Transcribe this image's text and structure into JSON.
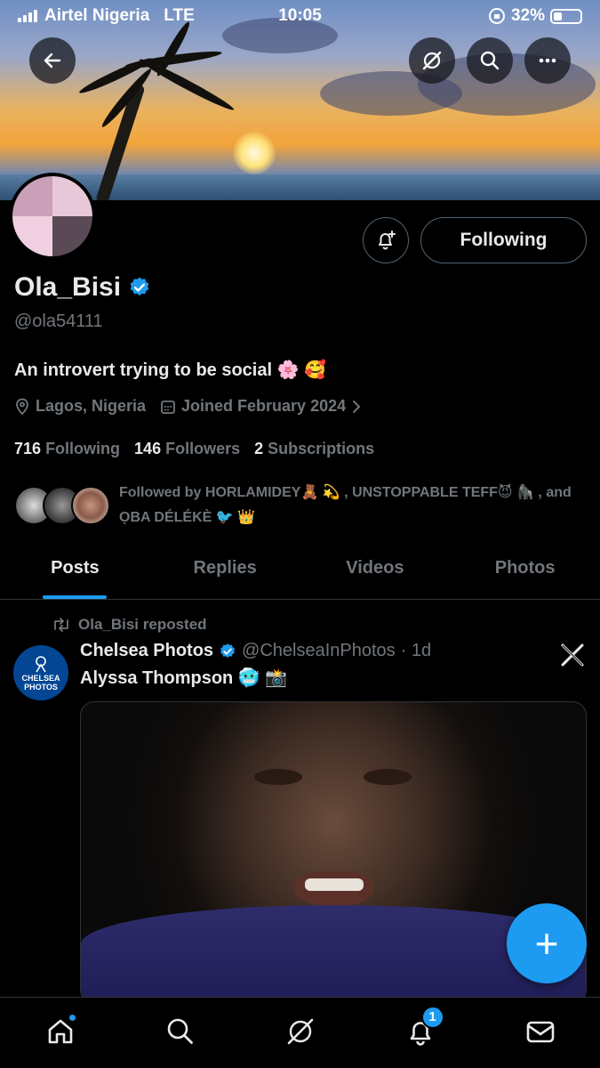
{
  "status_bar": {
    "carrier": "Airtel Nigeria",
    "network": "LTE",
    "time": "10:05",
    "battery": "32%"
  },
  "profile": {
    "display_name": "Ola_Bisi",
    "handle": "@ola54111",
    "bio": "An introvert trying to be social 🌸 🥰",
    "location": "Lagos, Nigeria",
    "joined": "Joined February 2024",
    "following_count": "716",
    "following_label": "Following",
    "followers_count": "146",
    "followers_label": "Followers",
    "subscriptions_count": "2",
    "subscriptions_label": "Subscriptions",
    "followed_by": "Followed by HORLAMIDEY🧸 💫 , UNSTOPPABLE TEFF😈 🦍 , and ỌBA DÉLÉKÈ 🐦 👑",
    "follow_button": "Following"
  },
  "tabs": [
    {
      "label": "Posts",
      "active": true
    },
    {
      "label": "Replies",
      "active": false
    },
    {
      "label": "Videos",
      "active": false
    },
    {
      "label": "Photos",
      "active": false
    }
  ],
  "post": {
    "repost_label": "Ola_Bisi reposted",
    "author_name": "Chelsea Photos",
    "author_handle": "@ChelseaInPhotos",
    "time": "· 1d",
    "text": "Alyssa Thompson 🥶 📸",
    "avatar_text_1": "CHELSEA",
    "avatar_text_2": "PHOTOS"
  },
  "fab": {
    "label": "+"
  },
  "nav": {
    "notification_badge": "1"
  },
  "colors": {
    "accent": "#1d9bf0",
    "background": "#000000",
    "muted": "#71767b",
    "text": "#e7e9ea"
  }
}
